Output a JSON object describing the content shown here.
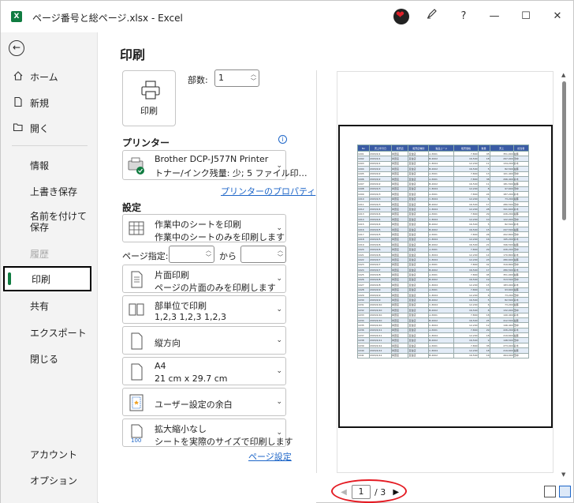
{
  "window": {
    "title": "ページ番号と総ページ.xlsx  -  Excel",
    "app_logo": "X"
  },
  "titlebar_icons": [
    "heart-avatar-icon",
    "pen-icon",
    "help-icon",
    "minimize-icon",
    "maximize-icon",
    "close-icon"
  ],
  "titlebar_glyphs": {
    "help": "?",
    "minimize": "—",
    "maximize": "☐",
    "close": "✕"
  },
  "sidebar": {
    "back_glyph": "←",
    "items": [
      {
        "label": "ホーム",
        "icon": "home-icon"
      },
      {
        "label": "新規",
        "icon": "new-document-icon"
      },
      {
        "label": "開く",
        "icon": "open-folder-icon"
      },
      {
        "label": "情報"
      },
      {
        "label": "上書き保存"
      },
      {
        "label": "名前を付けて保存"
      },
      {
        "label": "履歴",
        "disabled": true
      },
      {
        "label": "印刷",
        "selected": true
      },
      {
        "label": "共有"
      },
      {
        "label": "エクスポート"
      },
      {
        "label": "閉じる"
      },
      {
        "label": "アカウント"
      },
      {
        "label": "オプション"
      }
    ]
  },
  "print": {
    "title": "印刷",
    "print_button": "印刷",
    "copies_label": "部数:",
    "copies_value": "1",
    "printer_section": "プリンター",
    "printer_name": "Brother DCP-J577N Printer",
    "printer_status": "トナー/インク残量: 少; 5 ファイル印…",
    "printer_props": "プリンターのプロパティ",
    "settings_section": "設定",
    "scope_line1": "作業中のシートを印刷",
    "scope_line2": "作業中のシートのみを印刷します",
    "pages_label": "ページ指定:",
    "pages_to": "から",
    "sides_line1": "片面印刷",
    "sides_line2": "ページの片面のみを印刷します",
    "collate_line1": "部単位で印刷",
    "collate_line2": "1,2,3    1,2,3    1,2,3",
    "orientation": "縦方向",
    "paper_line1": "A4",
    "paper_line2": "21 cm x 29.7 cm",
    "margins": "ユーザー設定の余白",
    "scaling_line1": "拡大縮小なし",
    "scaling_line2": "シートを実際のサイズで印刷します",
    "page_setup": "ページ設定"
  },
  "preview": {
    "headers": [
      "No",
      "売上年月日",
      "販売店",
      "販売店種別",
      "製品コード",
      "販売価格",
      "数量",
      "売上",
      "担当者"
    ],
    "rows": [
      [
        "1001",
        "2003/4/1",
        "青葉店",
        "直営店",
        "A-3001",
        "7,800",
        "45",
        "351,000",
        "佐藤"
      ],
      [
        "1002",
        "2003/4/1",
        "青葉店",
        "直営店",
        "B-2002",
        "16,500",
        "18",
        "297,000",
        "田中"
      ],
      [
        "1003",
        "2003/4/1",
        "青葉店",
        "直営店",
        "C-3004",
        "12,200",
        "11",
        "134,200",
        "鈴木"
      ],
      [
        "1004",
        "2003/4/2",
        "青葉店",
        "直営店",
        "B-2002",
        "16,500",
        "5",
        "82,500",
        "佐藤"
      ],
      [
        "1005",
        "2003/4/2",
        "青葉店",
        "直営店",
        "A-3001",
        "7,800",
        "13",
        "101,400",
        "田中"
      ],
      [
        "1006",
        "2003/4/2",
        "青葉店",
        "直営店",
        "A-3001",
        "7,800",
        "38",
        "296,400",
        "鈴木"
      ],
      [
        "1007",
        "2003/4/2",
        "青葉店",
        "直営店",
        "B-2002",
        "16,500",
        "11",
        "181,500",
        "佐藤"
      ],
      [
        "1008",
        "2003/4/3",
        "青葉店",
        "直営店",
        "C-3004",
        "12,200",
        "8",
        "97,600",
        "田中"
      ],
      [
        "1009",
        "2003/4/3",
        "青葉店",
        "直営店",
        "A-3001",
        "7,800",
        "24",
        "187,200",
        "鈴木"
      ],
      [
        "1010",
        "2003/4/3",
        "青葉店",
        "直営店",
        "C-3004",
        "12,200",
        "6",
        "73,200",
        "佐藤"
      ],
      [
        "1011",
        "2003/4/3",
        "青葉店",
        "直営店",
        "B-2002",
        "16,500",
        "17",
        "280,500",
        "田中"
      ],
      [
        "1012",
        "2003/4/4",
        "青葉店",
        "直営店",
        "C-3004",
        "12,200",
        "28",
        "341,600",
        "鈴木"
      ],
      [
        "1013",
        "2003/4/4",
        "青葉店",
        "直営店",
        "A-3001",
        "7,800",
        "29",
        "226,200",
        "佐藤"
      ],
      [
        "1014",
        "2003/4/4",
        "青葉店",
        "直営店",
        "C-3004",
        "12,200",
        "10",
        "122,000",
        "田中"
      ],
      [
        "1015",
        "2003/4/4",
        "青葉店",
        "直営店",
        "B-2002",
        "16,500",
        "5",
        "82,500",
        "鈴木"
      ],
      [
        "1016",
        "2003/4/5",
        "青葉店",
        "直営店",
        "B-2002",
        "16,500",
        "15",
        "247,500",
        "佐藤"
      ],
      [
        "1017",
        "2003/4/5",
        "青葉店",
        "直営店",
        "A-3001",
        "7,800",
        "26",
        "202,800",
        "田中"
      ],
      [
        "1018",
        "2003/4/5",
        "青葉店",
        "直営店",
        "C-3004",
        "12,200",
        "16",
        "195,200",
        "鈴木"
      ],
      [
        "1019",
        "2003/4/6",
        "青葉店",
        "直営店",
        "B-2002",
        "16,500",
        "21",
        "346,500",
        "佐藤"
      ],
      [
        "1020",
        "2003/4/6",
        "青葉店",
        "直営店",
        "A-3001",
        "7,800",
        "29",
        "226,200",
        "田中"
      ],
      [
        "1021",
        "2003/4/6",
        "青葉店",
        "直営店",
        "C-3004",
        "12,200",
        "14",
        "170,800",
        "鈴木"
      ],
      [
        "1022",
        "2003/4/7",
        "青葉店",
        "直営店",
        "C-3004",
        "12,200",
        "23",
        "280,600",
        "佐藤"
      ],
      [
        "1023",
        "2003/4/7",
        "青葉店",
        "直営店",
        "A-3001",
        "7,800",
        "41",
        "319,800",
        "田中"
      ],
      [
        "1024",
        "2003/4/7",
        "青葉店",
        "直営店",
        "B-2002",
        "16,500",
        "17",
        "280,500",
        "鈴木"
      ],
      [
        "1025",
        "2003/4/8",
        "青葉店",
        "直営店",
        "A-3001",
        "7,800",
        "45",
        "351,000",
        "佐藤"
      ],
      [
        "1026",
        "2003/4/8",
        "青葉店",
        "直営店",
        "B-2002",
        "16,500",
        "19",
        "313,500",
        "田中"
      ],
      [
        "1027",
        "2003/4/8",
        "青葉店",
        "直営店",
        "C-3004",
        "12,200",
        "15",
        "183,000",
        "鈴木"
      ],
      [
        "1028",
        "2003/4/9",
        "青葉店",
        "直営店",
        "A-3001",
        "7,800",
        "12",
        "93,600",
        "佐藤"
      ],
      [
        "1029",
        "2003/4/9",
        "青葉店",
        "直営店",
        "C-3004",
        "12,200",
        "6",
        "73,200",
        "田中"
      ],
      [
        "1030",
        "2003/4/9",
        "青葉店",
        "直営店",
        "B-2002",
        "16,500",
        "5",
        "82,500",
        "鈴木"
      ],
      [
        "1031",
        "2003/4/10",
        "青葉店",
        "直営店",
        "C-3004",
        "12,200",
        "6",
        "73,200",
        "佐藤"
      ],
      [
        "1032",
        "2003/4/10",
        "青葉店",
        "直営店",
        "B-2002",
        "16,500",
        "8",
        "132,000",
        "田中"
      ],
      [
        "1033",
        "2003/4/10",
        "青葉店",
        "直営店",
        "A-3001",
        "7,800",
        "18",
        "140,400",
        "鈴木"
      ],
      [
        "1034",
        "2003/4/10",
        "青葉店",
        "直営店",
        "B-2002",
        "16,500",
        "25",
        "412,500",
        "佐藤"
      ],
      [
        "1035",
        "2003/4/10",
        "青葉店",
        "直営店",
        "C-3004",
        "12,200",
        "12",
        "146,400",
        "田中"
      ],
      [
        "1036",
        "2003/4/11",
        "青葉店",
        "直営店",
        "A-3001",
        "7,800",
        "29",
        "226,200",
        "鈴木"
      ],
      [
        "1037",
        "2003/4/11",
        "青葉店",
        "直営店",
        "C-3004",
        "12,200",
        "18",
        "219,600",
        "佐藤"
      ],
      [
        "1038",
        "2003/4/11",
        "青葉店",
        "直営店",
        "B-2002",
        "16,500",
        "9",
        "148,500",
        "田中"
      ],
      [
        "1039",
        "2003/4/12",
        "青葉店",
        "直営店",
        "A-3001",
        "7,800",
        "35",
        "273,000",
        "鈴木"
      ],
      [
        "1040",
        "2003/4/12",
        "青葉店",
        "直営店",
        "C-3004",
        "12,200",
        "18",
        "219,600",
        "佐藤"
      ],
      [
        "1041",
        "2003/4/12",
        "青葉店",
        "直営店",
        "B-2002",
        "16,500",
        "16",
        "264,000",
        "田中"
      ]
    ]
  },
  "pager": {
    "current": "1",
    "total": "/ 3"
  },
  "colors": {
    "excel_green": "#107c41",
    "link": "#1e66c8",
    "highlight": "#e41b23",
    "table_header": "#3a5ba4"
  }
}
